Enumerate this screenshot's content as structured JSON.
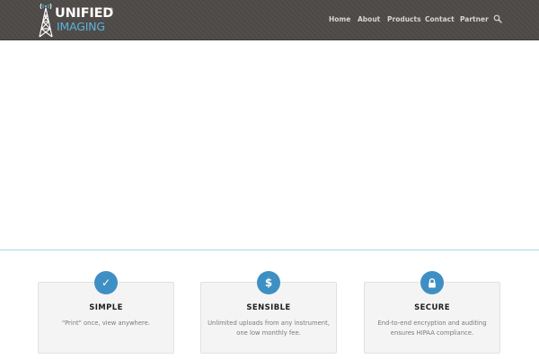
{
  "brand": {
    "name_line1": "UNIFIED",
    "name_line2": "IMAGING",
    "trademark": "®",
    "logo_icon": "radio-tower-icon",
    "colors": {
      "header_bg": "#4e4a47",
      "accent": "#5ab2de",
      "feature_icon_bg": "#3e8fc4"
    }
  },
  "nav": {
    "items": [
      {
        "label": "Home"
      },
      {
        "label": "About"
      },
      {
        "label": "Products"
      },
      {
        "label": "Contact"
      },
      {
        "label": "Partner"
      }
    ],
    "search_icon": "search-icon"
  },
  "features": [
    {
      "icon": "checkmark-icon",
      "glyph": "✓",
      "title": "SIMPLE",
      "line1": "\"Print\" once, view anywhere.",
      "line2": ""
    },
    {
      "icon": "dollar-icon",
      "glyph": "$",
      "title": "SENSIBLE",
      "line1": "Unlimited uploads from any instrument,",
      "line2": "one low monthly fee."
    },
    {
      "icon": "lock-icon",
      "glyph": "",
      "title": "SECURE",
      "line1": "End-to-end encryption and auditing",
      "line2": "ensures HIPAA compliance."
    }
  ]
}
